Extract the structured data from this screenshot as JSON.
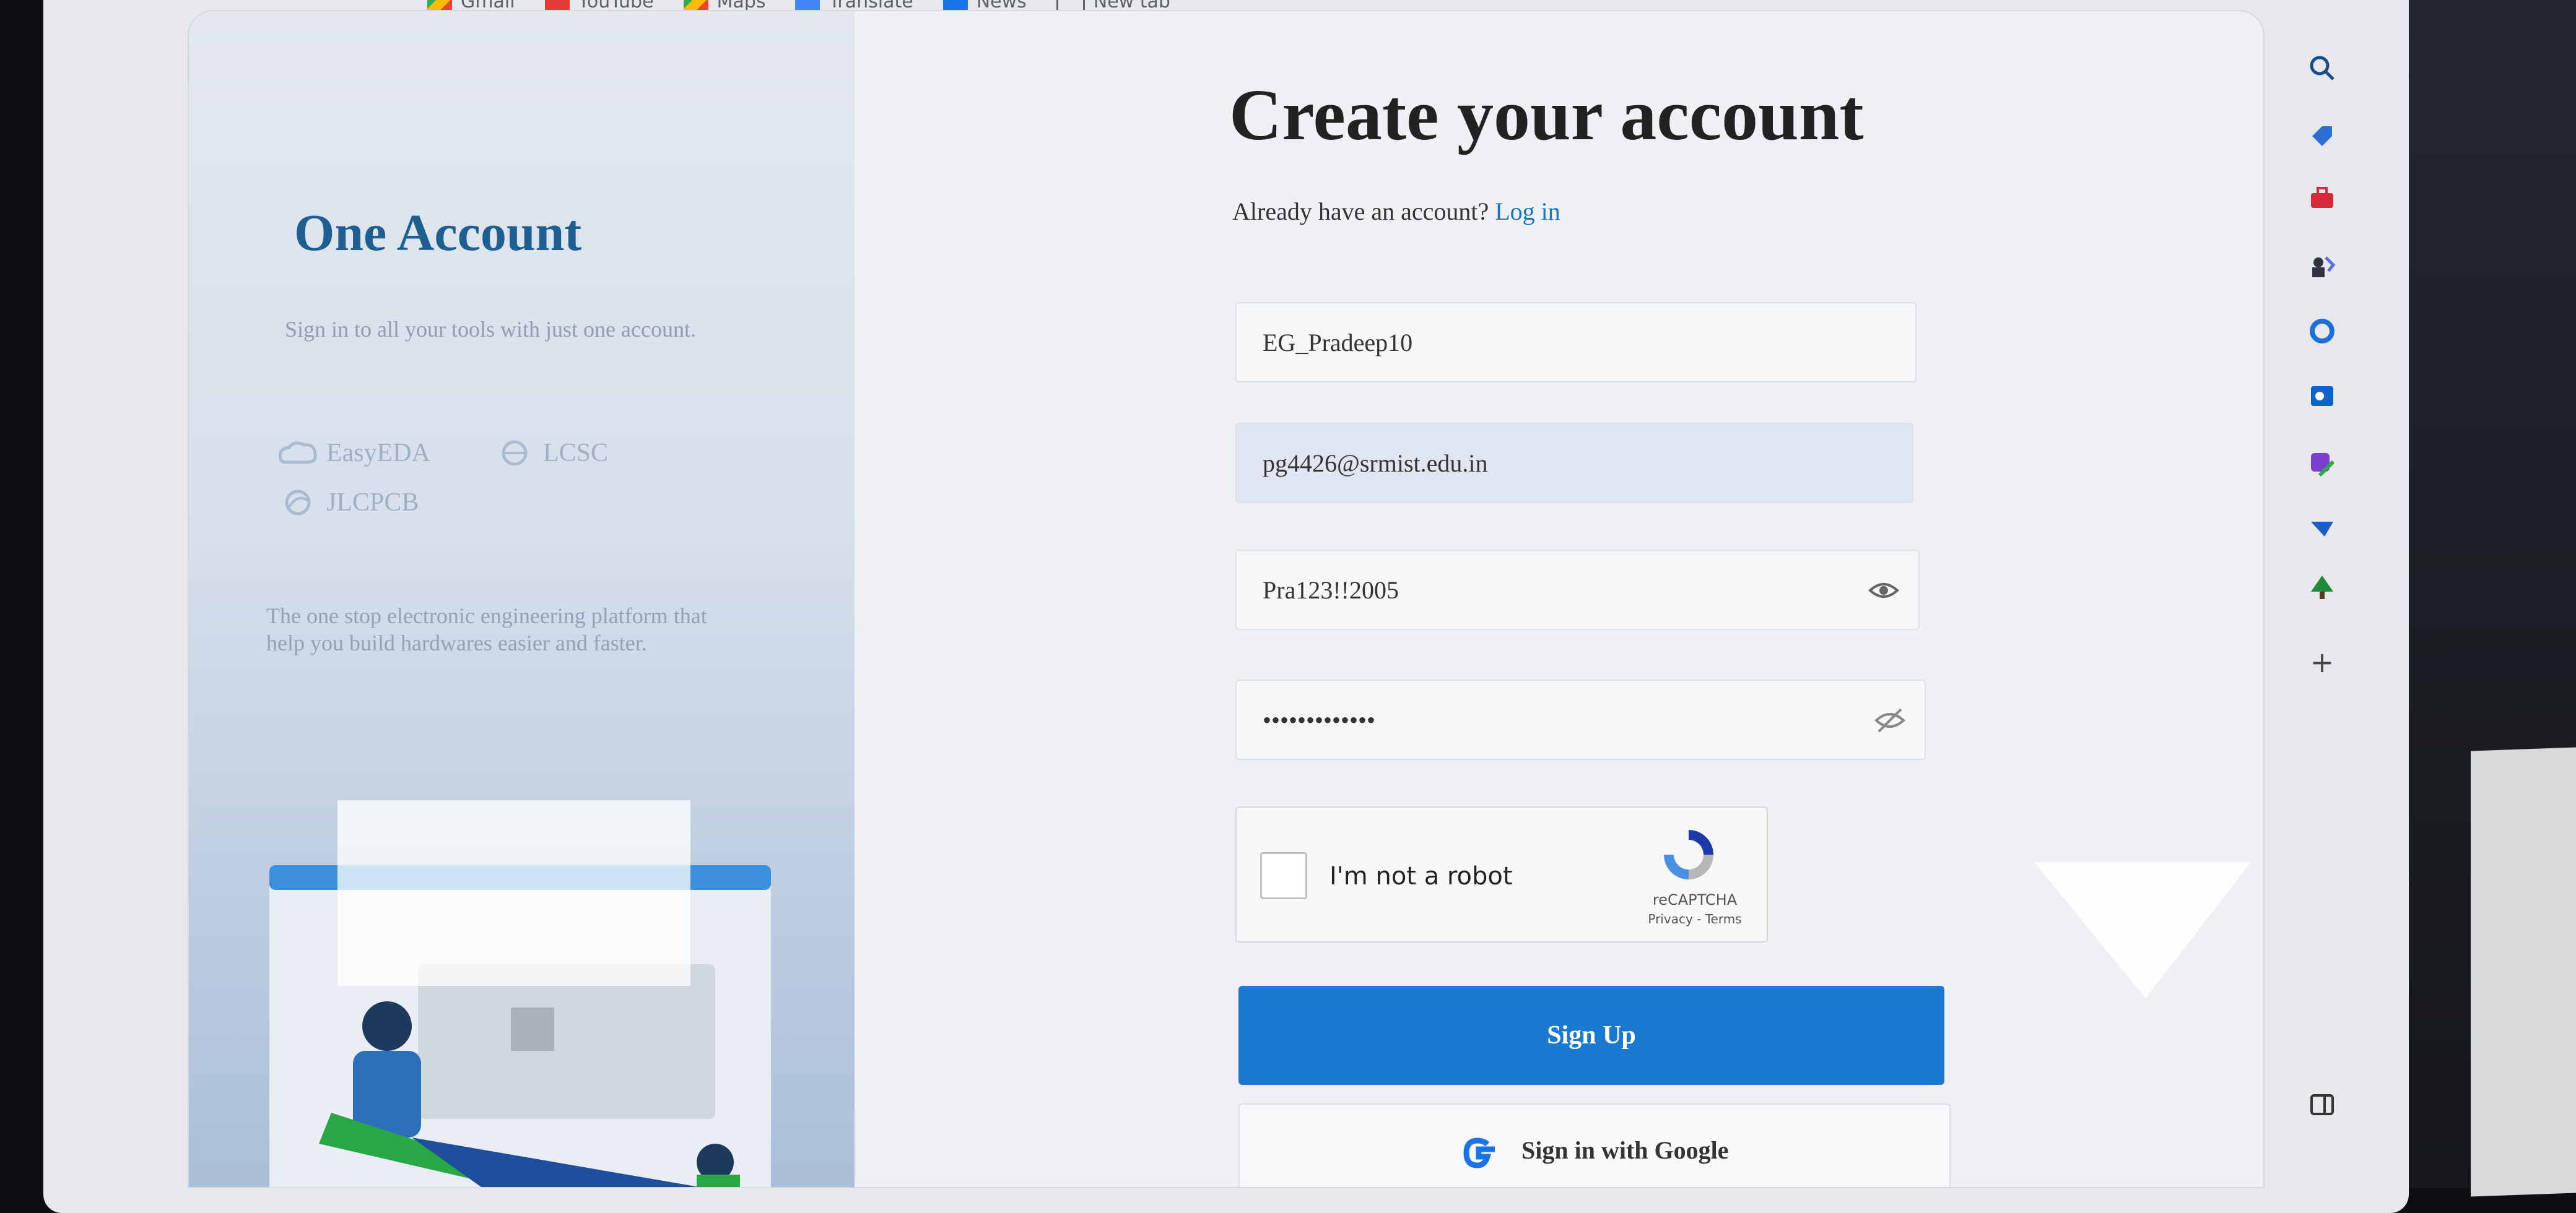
{
  "bookmarks": [
    {
      "label": "Gmail"
    },
    {
      "label": "YouTube"
    },
    {
      "label": "Maps"
    },
    {
      "label": "Translate"
    },
    {
      "label": "News"
    },
    {
      "label": "New tab"
    }
  ],
  "left": {
    "title": "One Account",
    "subtitle": "Sign in to all your tools with just one account.",
    "tools": [
      "EasyEDA",
      "LCSC",
      "JLCPCB"
    ],
    "tagline": "The one stop electronic engineering platform that help you build hardwares easier and faster."
  },
  "form": {
    "title": "Create your account",
    "login_prompt": "Already have an account?",
    "login_link": "Log in",
    "username": "EG_Pradeep10",
    "email": "pg4426@srmist.edu.in",
    "password": "Pra123!!2005",
    "confirm_password": "•••••••••••••",
    "captcha_label": "I'm not a robot",
    "captcha_brand": "reCAPTCHA",
    "captcha_links": "Privacy - Terms",
    "signup_label": "Sign Up",
    "google_label": "Sign in with Google"
  },
  "sidebar": {
    "icons": [
      "search-icon",
      "tag-icon",
      "toolbox-icon",
      "chess-icon",
      "copilot-icon",
      "outlook-icon",
      "designer-icon",
      "send-icon",
      "tree-icon",
      "add-icon",
      "panel-icon"
    ],
    "add_symbol": "+"
  },
  "colors": {
    "brand_blue": "#1e5f92",
    "button_blue": "#1b7ad0",
    "link_blue": "#1a73c0"
  }
}
